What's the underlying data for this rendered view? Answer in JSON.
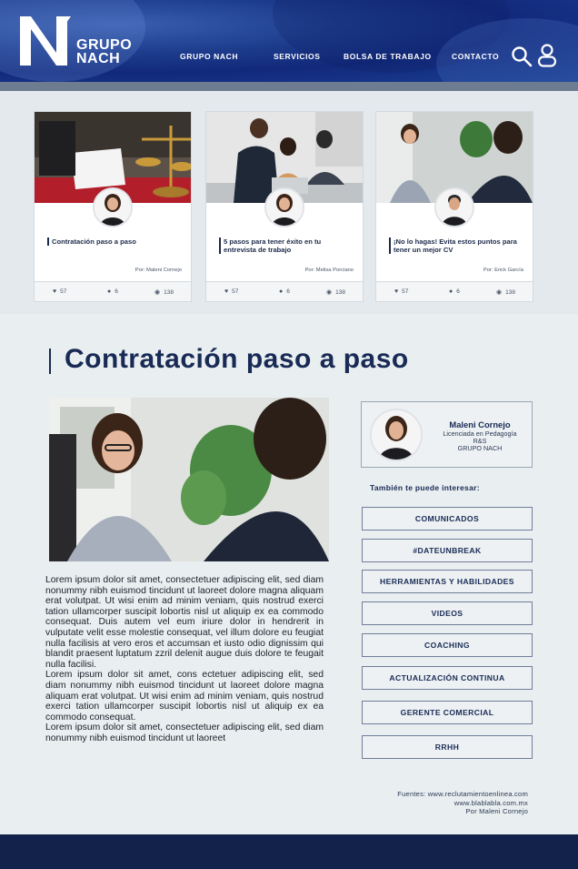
{
  "brand": {
    "name_line1": "GRUPO",
    "name_line2": "NACH",
    "colors": {
      "primary": "#182a55",
      "header": "#1d3c8c",
      "footer": "#13224b"
    }
  },
  "nav": {
    "items": [
      "GRUPO NACH",
      "SERVICIOS",
      "BOLSA DE TRABAJO",
      "CONTACTO"
    ]
  },
  "header_icons": [
    "search-icon",
    "user-icon"
  ],
  "cards": [
    {
      "title": "Contratación paso a paso",
      "author": "Por: Maleni Cornejo",
      "likes": "57",
      "comments": "6",
      "views": "138"
    },
    {
      "title": "5 pasos para tener éxito en tu entrevista de trabajo",
      "author": "Por: Melisa Porciano",
      "likes": "57",
      "comments": "6",
      "views": "138"
    },
    {
      "title": "¡No lo hagas! Evita estos puntos para tener un mejor CV",
      "author": "Por: Erick García",
      "likes": "57",
      "comments": "6",
      "views": "138"
    }
  ],
  "article": {
    "title": "Contratación paso a paso",
    "paragraphs": [
      "Lorem ipsum dolor sit amet, consectetuer adipiscing elit, sed diam nonummy nibh euismod tincidunt ut laoreet dolore magna aliquam erat volutpat. Ut wisi enim ad minim veniam, quis nostrud exerci tation ullamcorper suscipit lobortis nisl ut aliquip ex ea commodo consequat. Duis autem vel eum iriure dolor in hendrerit in vulputate velit esse molestie consequat, vel illum dolore eu feugiat nulla facilisis at vero eros et accumsan et iusto odio dignissim qui blandit praesent luptatum zzril delenit augue duis dolore te feugait nulla facilisi.",
      "Lorem ipsum dolor sit amet, cons ectetuer adipiscing elit, sed diam nonummy nibh euismod tincidunt ut laoreet dolore magna aliquam erat volutpat. Ut wisi enim ad minim veniam, quis nostrud exerci tation ullamcorper suscipit lobortis nisl ut aliquip ex ea commodo consequat.",
      "Lorem ipsum dolor sit amet, consectetuer adipiscing elit, sed diam nonummy nibh euismod tincidunt ut laoreet"
    ]
  },
  "author_box": {
    "name": "Maleni Cornejo",
    "role_line1": "Licenciada en Pedagogía",
    "role_line2": "R&S",
    "role_line3": "GRUPO NACH"
  },
  "related": {
    "heading": "También te puede interesar:",
    "tags": [
      "COMUNICADOS",
      "#DATEUNBREAK",
      "HERRAMIENTAS Y HABILIDADES",
      "VIDEOS",
      "COACHING",
      "ACTUALIZACIÓN CONTINUA",
      "GERENTE COMERCIAL",
      "RRHH"
    ]
  },
  "sources": {
    "line1": "Fuentes: www.reclutamientoenlinea.com",
    "line2": "www.blablabla.com.mx",
    "line3": "Por Maleni Cornejo"
  }
}
